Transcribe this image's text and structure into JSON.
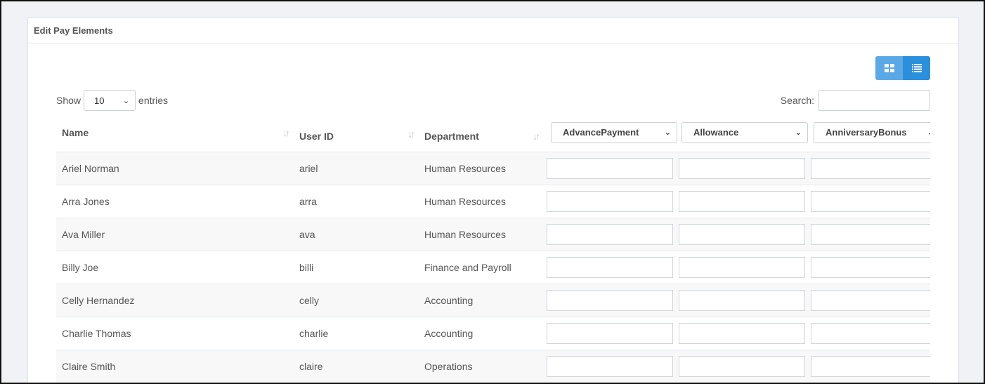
{
  "card": {
    "title": "Edit Pay Elements"
  },
  "view_toggle": {
    "grid_icon": "grid-view-icon",
    "list_icon": "list-view-icon",
    "grid_color": "#5aa9e6",
    "list_color": "#2b8fdc"
  },
  "length": {
    "show_label": "Show",
    "value": "10",
    "entries_label": "entries"
  },
  "search": {
    "label": "Search:",
    "value": "",
    "placeholder": ""
  },
  "table": {
    "headers": {
      "name": "Name",
      "user_id": "User ID",
      "department": "Department"
    },
    "element_selects": [
      "AdvancePayment",
      "Allowance",
      "AnniversaryBonus"
    ],
    "rows": [
      {
        "name": "Ariel Norman",
        "user_id": "ariel",
        "department": "Human Resources"
      },
      {
        "name": "Arra Jones",
        "user_id": "arra",
        "department": "Human Resources"
      },
      {
        "name": "Ava Miller",
        "user_id": "ava",
        "department": "Human Resources"
      },
      {
        "name": "Billy Joe",
        "user_id": "billi",
        "department": "Finance and Payroll"
      },
      {
        "name": "Celly Hernandez",
        "user_id": "celly",
        "department": "Accounting"
      },
      {
        "name": "Charlie Thomas",
        "user_id": "charlie",
        "department": "Accounting"
      },
      {
        "name": "Claire Smith",
        "user_id": "claire",
        "department": "Operations"
      }
    ]
  }
}
